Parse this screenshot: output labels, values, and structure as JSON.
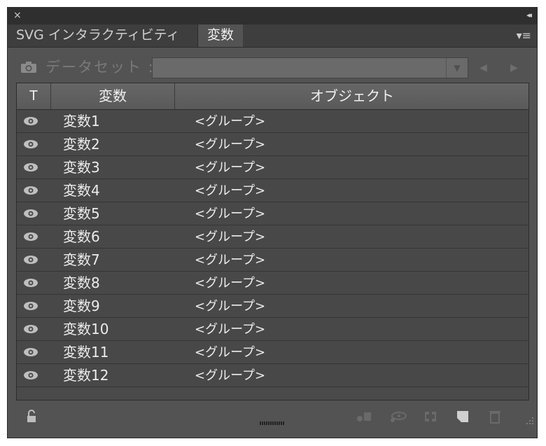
{
  "panel": {
    "close_glyph": "×",
    "collapse_glyph": "◂◂",
    "menu_glyph": "▾≡"
  },
  "tabs": [
    {
      "label": "SVG インタラクティビティ",
      "active": false
    },
    {
      "label": "変数",
      "active": true
    }
  ],
  "dataset": {
    "label": "データセット :",
    "value": ""
  },
  "table": {
    "headers": [
      "T",
      "変数",
      "オブジェクト"
    ],
    "rows": [
      {
        "name": "変数1",
        "object": "<グループ>"
      },
      {
        "name": "変数2",
        "object": "<グループ>"
      },
      {
        "name": "変数3",
        "object": "<グループ>"
      },
      {
        "name": "変数4",
        "object": "<グループ>"
      },
      {
        "name": "変数5",
        "object": "<グループ>"
      },
      {
        "name": "変数6",
        "object": "<グループ>"
      },
      {
        "name": "変数7",
        "object": "<グループ>"
      },
      {
        "name": "変数8",
        "object": "<グループ>"
      },
      {
        "name": "変数9",
        "object": "<グループ>"
      },
      {
        "name": "変数10",
        "object": "<グループ>"
      },
      {
        "name": "変数11",
        "object": "<グループ>"
      },
      {
        "name": "変数12",
        "object": "<グループ>"
      }
    ]
  },
  "footer_icons": [
    "lock-icon",
    "make-object-dynamic-icon",
    "make-visibility-dynamic-icon",
    "unbind-icon",
    "new-variable-icon",
    "delete-icon"
  ],
  "colors": {
    "panel_bg": "#535353",
    "titlebar_bg": "#2f2f2f",
    "row_bg": "#484848",
    "text": "#ececec"
  }
}
